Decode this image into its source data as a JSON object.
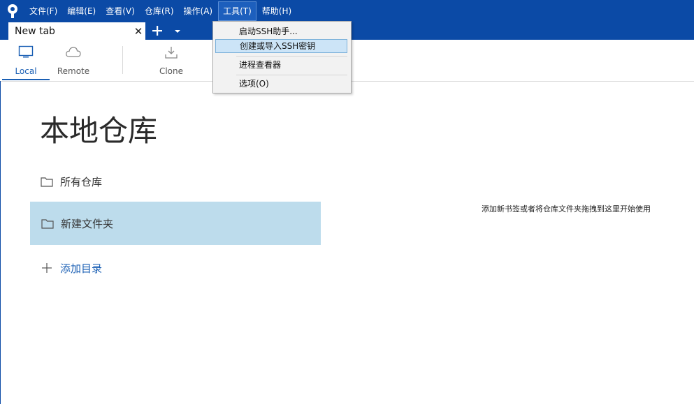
{
  "menu": {
    "items": [
      {
        "label": "文件(F)"
      },
      {
        "label": "编辑(E)"
      },
      {
        "label": "查看(V)"
      },
      {
        "label": "仓库(R)"
      },
      {
        "label": "操作(A)"
      },
      {
        "label": "工具(T)"
      },
      {
        "label": "帮助(H)"
      }
    ],
    "active_index": 5
  },
  "tabs": {
    "active_label": "New tab",
    "close_symbol": "✕"
  },
  "toolbar": {
    "local": "Local",
    "remote": "Remote",
    "clone": "Clone"
  },
  "main": {
    "title": "本地仓库",
    "all_repos": "所有仓库",
    "new_folder": "新建文件夹",
    "add_directory": "添加目录",
    "hint": "添加新书签或者将仓库文件夹拖拽到这里开始使用"
  },
  "tools_menu": {
    "items": [
      {
        "label": "启动SSH助手..."
      },
      {
        "label": "创建或导入SSH密钥"
      },
      {
        "label": "进程查看器"
      },
      {
        "label": "选项(O)"
      }
    ],
    "highlighted_index": 1
  },
  "colors": {
    "brand_blue": "#0b4aa6",
    "selection": "#bddcec",
    "link": "#1a5fb4"
  },
  "icons": {
    "logo": "sourcetree-logo-icon",
    "local": "monitor-icon",
    "remote": "cloud-icon",
    "clone": "download-icon",
    "folder": "folder-icon",
    "add": "plus-icon",
    "new_tab": "plus-icon",
    "tab_dropdown": "chevron-down-icon"
  }
}
